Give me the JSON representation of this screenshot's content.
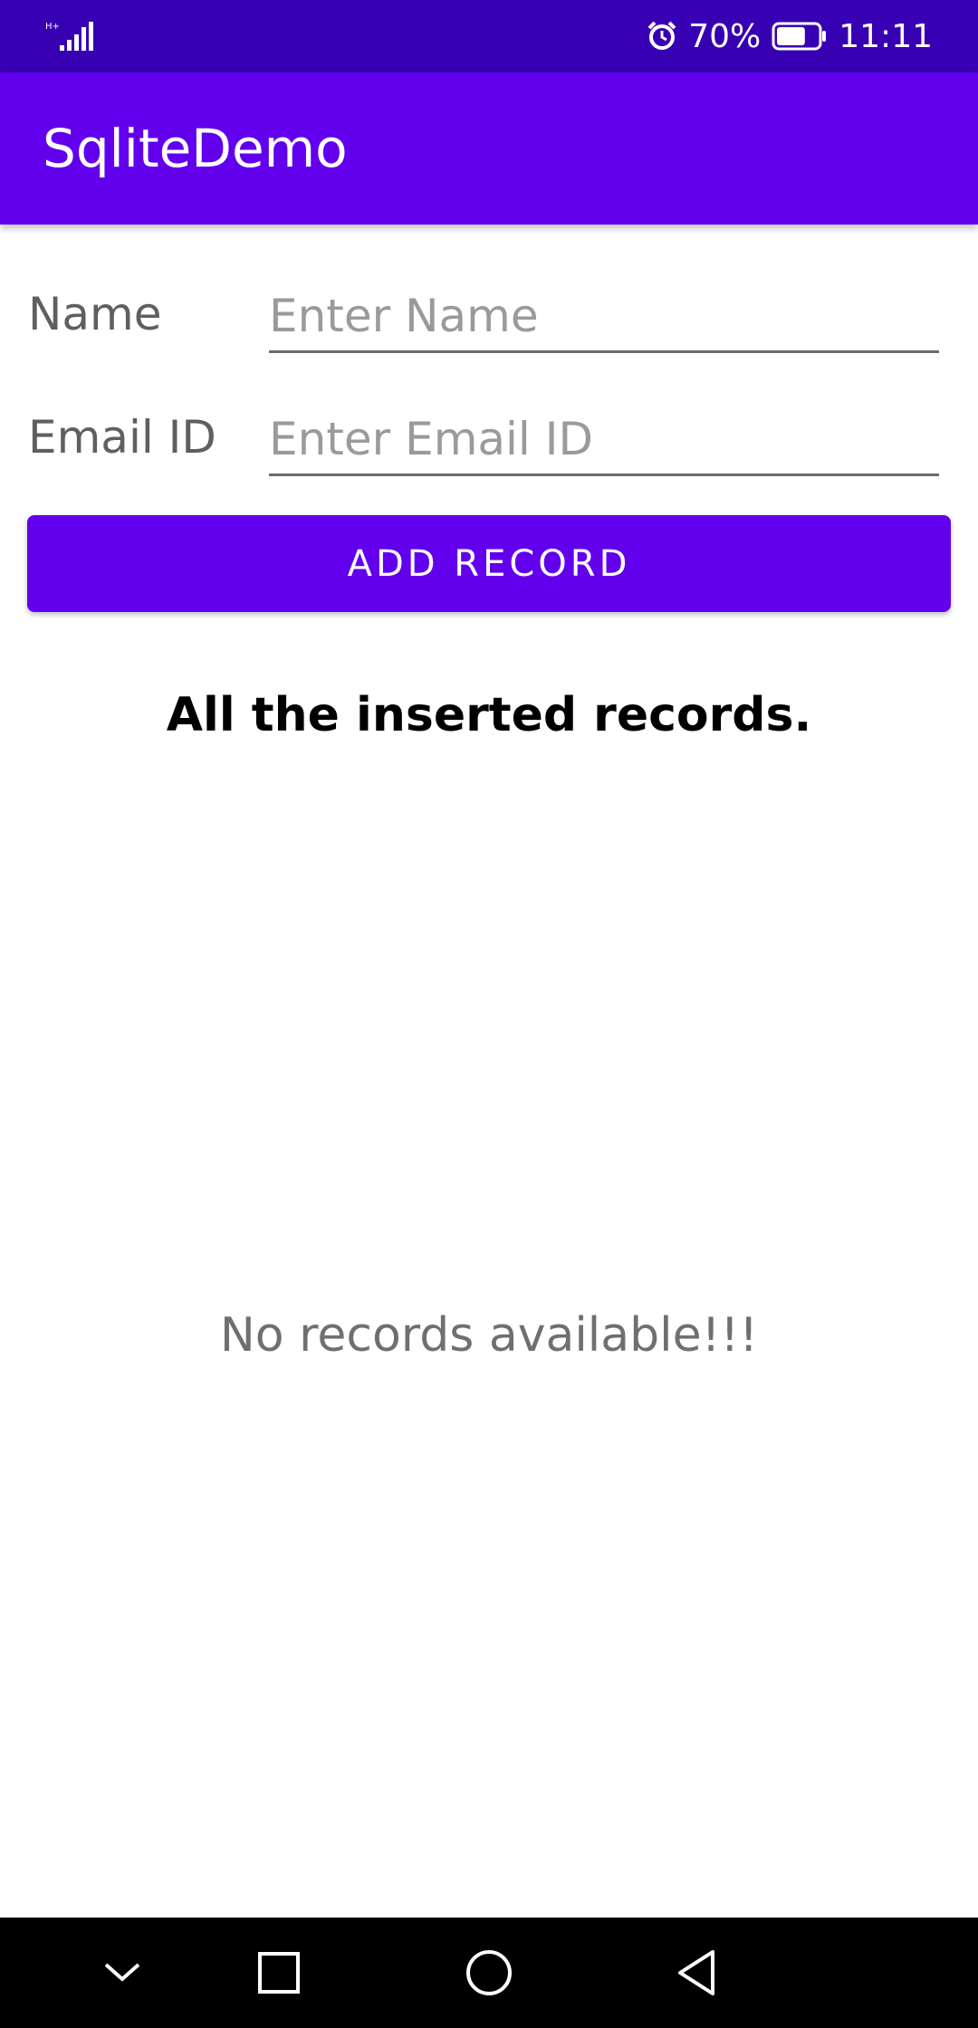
{
  "status_bar": {
    "signal_icon": "signal-bars-icon",
    "alarm_icon": "alarm-clock-icon",
    "battery_percent": "70%",
    "battery_level": 0.7,
    "time": "11:11"
  },
  "app_bar": {
    "title": "SqliteDemo",
    "color": "#6200ee"
  },
  "form": {
    "name_label": "Name",
    "name_placeholder": "Enter Name",
    "name_value": "",
    "email_label": "Email ID",
    "email_placeholder": "Enter Email ID",
    "email_value": "",
    "add_button_label": "ADD RECORD"
  },
  "records": {
    "heading": "All the inserted records.",
    "empty_message": "No records available!!!",
    "items": []
  },
  "nav_bar": {
    "buttons": [
      "chevron-down-icon",
      "recents-square-icon",
      "home-circle-icon",
      "back-triangle-icon"
    ]
  },
  "colors": {
    "status_bar": "#3700b3",
    "primary": "#6200ee",
    "nav_bar": "#000000"
  }
}
